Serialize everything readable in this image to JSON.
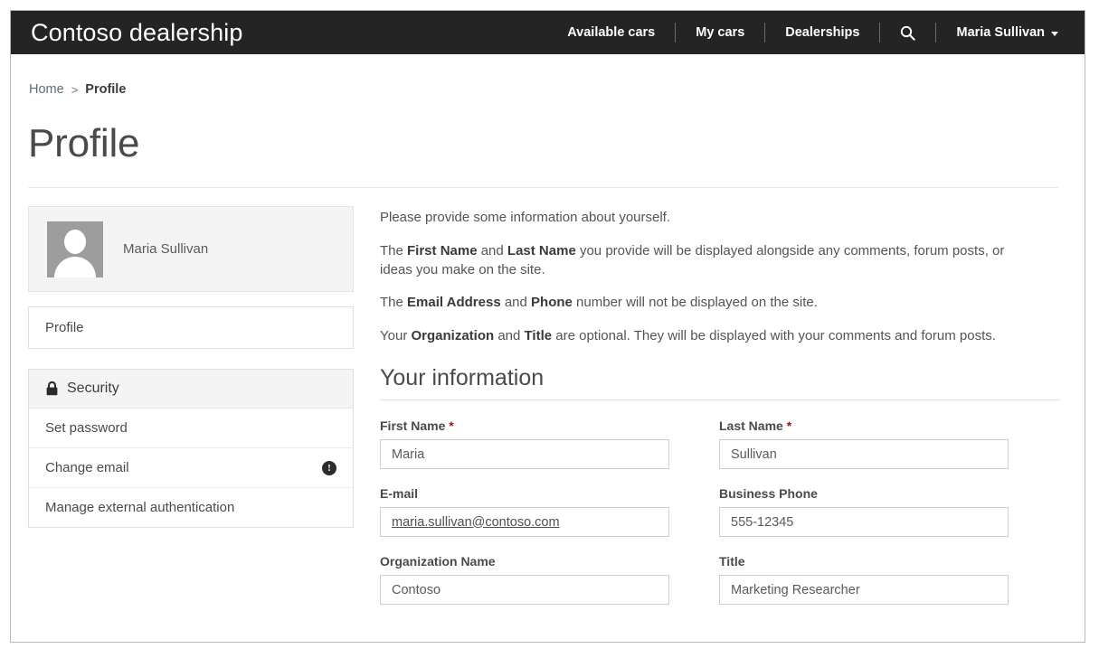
{
  "navbar": {
    "brand": "Contoso dealership",
    "links": [
      {
        "label": "Available cars"
      },
      {
        "label": "My cars"
      },
      {
        "label": "Dealerships"
      }
    ],
    "search_icon": "search-icon",
    "user": "Maria Sullivan"
  },
  "breadcrumb": {
    "home": "Home",
    "separator": ">",
    "current": "Profile"
  },
  "page": {
    "title": "Profile"
  },
  "sidebar": {
    "profile_card": {
      "avatar_icon": "user-avatar-placeholder",
      "name": "Maria Sullivan"
    },
    "nav_items": [
      {
        "label": "Profile"
      }
    ],
    "security": {
      "icon": "lock-icon",
      "heading": "Security",
      "items": [
        {
          "label": "Set password",
          "badge": ""
        },
        {
          "label": "Change email",
          "badge": "!"
        },
        {
          "label": "Manage external authentication",
          "badge": ""
        }
      ]
    }
  },
  "main": {
    "intro": {
      "p1": "Please provide some information about yourself.",
      "p2_a": "The ",
      "p2_b1": "First Name",
      "p2_c": " and ",
      "p2_b2": "Last Name",
      "p2_d": " you provide will be displayed alongside any comments, forum posts, or ideas you make on the site.",
      "p3_a": "The ",
      "p3_b1": "Email Address",
      "p3_c": " and ",
      "p3_b2": "Phone",
      "p3_d": " number will not be displayed on the site.",
      "p4_a": "Your ",
      "p4_b1": "Organization",
      "p4_c": " and ",
      "p4_b2": "Title",
      "p4_d": " are optional. They will be displayed with your comments and forum posts."
    },
    "section_title": "Your information",
    "fields": {
      "first_name": {
        "label": "First Name",
        "required": "*",
        "value": "Maria"
      },
      "last_name": {
        "label": "Last Name",
        "required": "*",
        "value": "Sullivan"
      },
      "email": {
        "label": "E-mail",
        "value": "maria.sullivan@contoso.com"
      },
      "business_phone": {
        "label": "Business Phone",
        "value": "555-12345"
      },
      "organization": {
        "label": "Organization Name",
        "value": "Contoso"
      },
      "title": {
        "label": "Title",
        "value": "Marketing Researcher"
      }
    }
  },
  "colors": {
    "navbar_bg": "#242424",
    "required_asterisk": "#8a1f1f",
    "card_bg": "#f4f4f4",
    "border": "#e0e0e0"
  }
}
